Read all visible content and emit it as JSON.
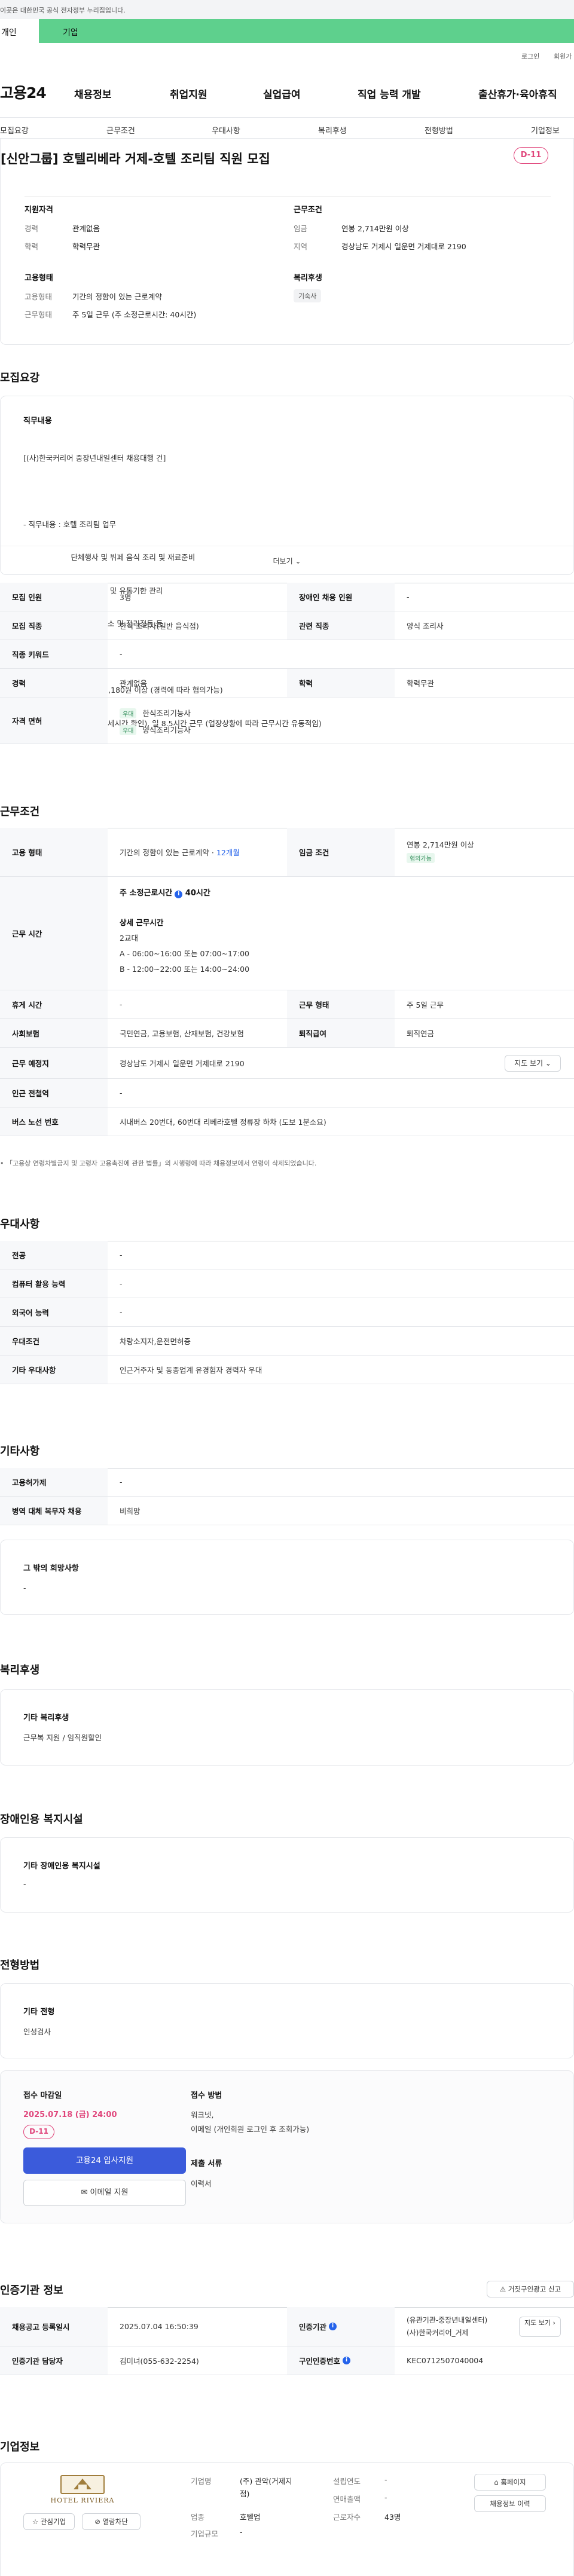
{
  "gov_banner": "이곳은 대한민국 공식 전자정부 누리집입니다.",
  "audience_tabs": {
    "individual": "개인",
    "business": "기업"
  },
  "util": {
    "login": "로그인",
    "signup": "회원가"
  },
  "logo": "고용24",
  "gnb": [
    "채용정보",
    "취업지원",
    "실업급여",
    "직업 능력 개발",
    "출산휴가·육아휴직"
  ],
  "subnav": [
    "모집요강",
    "근무조건",
    "우대사항",
    "복리후생",
    "전형방법",
    "기업정보"
  ],
  "job": {
    "title": "[신안그룹] 호텔리베라 거제-호텔 조리팀 직원 모집",
    "dday": "D-11",
    "qual_heading": "지원자격",
    "qual": [
      {
        "label": "경력",
        "value": "관계없음"
      },
      {
        "label": "학력",
        "value": "학력무관"
      }
    ],
    "cond_heading": "근무조건",
    "cond": [
      {
        "label": "임금",
        "value": "연봉 2,714만원 이상"
      },
      {
        "label": "지역",
        "value": "경상남도 거제시 일운면 거제대로 2190"
      }
    ],
    "emp_heading": "고용형태",
    "emp": [
      {
        "label": "고용형태",
        "value": "기간의 정함이 있는 근로계약"
      },
      {
        "label": "근무형태",
        "value": "주 5일 근무 (주 소정근로시간: 40시간)"
      }
    ],
    "welfare_heading": "복리후생",
    "welfare_tag": "기숙사"
  },
  "recruit": {
    "heading": "모집요강",
    "duty_title": "직무내용",
    "duty_lines": [
      "[(사)한국커리어 중장년내일센터 채용대행 건]",
      "",
      "- 직무내용 : 호텔 조리팀 업무",
      "                    단체행사 및 뷔페 음식 조리 및 재료준비",
      "                    식자재 발주 및 유통기한 관리",
      "                    조리기구 청소 및 정리정돈 등",
      "- 모집인원 : 3명",
      "- 급       여 : 연봉 27,141,180원 이상 (경력에 따라 협의가능)",
      "- 근무시간 : 2교대 근무(상세시간 확인), 일 8.5시간 근무 (업장상황에 따라 근무시간 유동적임)"
    ],
    "more": "더보기",
    "rows": [
      {
        "h1": "모집 인원",
        "v1": "3명",
        "h2": "장애인 채용 인원",
        "v2": "-"
      },
      {
        "h1": "모집 직종",
        "v1": "한식 조리사(일반 음식점)",
        "h2": "관련 직종",
        "v2": "양식 조리사"
      },
      {
        "h1": "직종 키워드",
        "v1": "-"
      },
      {
        "h1": "경력",
        "v1": "관계없음",
        "h2": "학력",
        "v2": "학력무관"
      }
    ],
    "license_h": "자격 면허",
    "license_badge": "우대",
    "licenses": [
      "한식조리기능사",
      "양식조리기능사"
    ]
  },
  "work": {
    "heading": "근무조건",
    "emp_h": "고용 형태",
    "emp_v": "기간의 정함이 있는 근로계약 · ",
    "emp_v2": "12개월",
    "wage_h": "임금 조건",
    "wage_v": "연봉 2,714만원 이상",
    "wage_tag": "협의가능",
    "hours_h": "근무 시간",
    "hours_std": "주 소정근로시간",
    "hours_std_v": "40시간",
    "hours_detail_h": "상세 근무시간",
    "hours_detail": [
      "2교대",
      "A - 06:00~16:00 또는 07:00~17:00",
      "B - 12:00~22:00 또는 14:00~24:00"
    ],
    "rows": [
      {
        "h1": "휴게 시간",
        "v1": "-",
        "h2": "근무 형태",
        "v2": "주 5일 근무"
      },
      {
        "h1": "사회보험",
        "v1": "국민연금, 고용보험, 산재보험, 건강보험",
        "h2": "퇴직급여",
        "v2": "퇴직연금"
      }
    ],
    "place_h": "근무 예정지",
    "place_v": "경상남도 거제시 일운면 거제대로 2190",
    "map_btn": "지도 보기",
    "station_h": "인근 전철역",
    "station_v": "-",
    "bus_h": "버스 노선 번호",
    "bus_v": "시내버스 20번대, 60번대 리베라호텔 정류장 하차 (도보 1분소요)",
    "note": "「고용상 연령차별금지 및 고령자 고용촉진에 관한 법률」의 시행령에 따라 채용정보에서 연령이 삭제되었습니다."
  },
  "pref": {
    "heading": "우대사항",
    "rows": [
      {
        "h": "전공",
        "v": "-"
      },
      {
        "h": "컴퓨터 활용 능력",
        "v": "-"
      },
      {
        "h": "외국어 능력",
        "v": "-"
      },
      {
        "h": "우대조건",
        "v": "차량소지자,운전면허증"
      },
      {
        "h": "기타 우대사항",
        "v": "인근거주자 및 동종업계 유경험자 경력자 우대"
      }
    ]
  },
  "etc": {
    "heading": "기타사항",
    "rows": [
      {
        "h": "고용허가제",
        "v": "-"
      },
      {
        "h": "병역 대체 복무자 채용",
        "v": "비희망"
      }
    ],
    "other_title": "그 밖의 희망사항",
    "other_v": "-"
  },
  "benefit": {
    "heading": "복리후생",
    "title": "기타 복리후생",
    "v": "근무복 지원 / 임직원할인"
  },
  "disabled": {
    "heading": "장애인용 복지시설",
    "title": "기타 장애인용 복지시설",
    "v": "-"
  },
  "screening": {
    "heading": "전형방법",
    "other_title": "기타 전형",
    "other_v": "인성검사",
    "deadline_h": "접수 마감일",
    "deadline_v": "2025.07.18 (금) 24:00",
    "dday": "D-11",
    "apply_btn": "고용24 입사지원",
    "email_btn": "이메일 지원",
    "method_h": "접수 방법",
    "method_v": [
      "워크넷,",
      "이메일 (개인회원 로그인 후 조회가능)"
    ],
    "docs_h": "제출 서류",
    "docs_v": "이력서"
  },
  "agency": {
    "heading": "인증기관 정보",
    "report_btn": "거짓구인광고 신고",
    "reg_h": "채용공고 등록일시",
    "reg_v": "2025.07.04 16:50:39",
    "org_h": "인증기관",
    "org_v": [
      "(유관기관-중장년내일센터)",
      "(사)한국커리어_거제"
    ],
    "org_btn": "지도 보기",
    "staff_h": "인증기관 담당자",
    "staff_v": "김미녀(055-632-2254)",
    "code_h": "구인인증번호",
    "code_v": "KEC0712507040004"
  },
  "company": {
    "heading": "기업정보",
    "logo_text": "HOTEL RIVIERA",
    "fav_btn": "관심기업",
    "block_btn": "열람차단",
    "name_h": "기업명",
    "name_v": "(주) 관악(거제지점)",
    "ind_h": "업종",
    "ind_v": "호텔업",
    "size_h": "기업규모",
    "size_v": "-",
    "year_h": "설립연도",
    "year_v": "-",
    "sales_h": "연매출액",
    "sales_v": "-",
    "emp_h": "근로자수",
    "emp_v": "43명",
    "home_btn": "홈페이지",
    "history_btn": "채용정보 이력"
  }
}
